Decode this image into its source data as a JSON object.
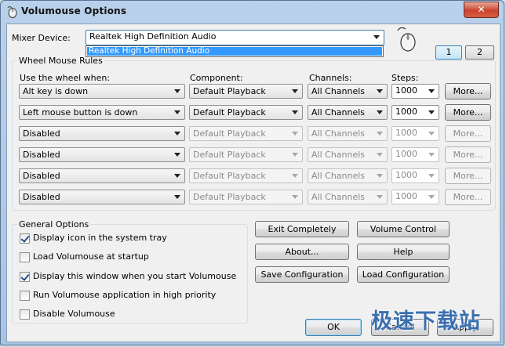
{
  "window": {
    "title": "Volumouse Options",
    "close_label": "✕"
  },
  "mixer": {
    "label": "Mixer Device:",
    "selected": "Realtek High Definition Audio",
    "dropdown_option": "Realtek High Definition Audio"
  },
  "tabs": [
    "1",
    "2"
  ],
  "rules": {
    "group_title": "Wheel Mouse Rules",
    "headers": {
      "use_when": "Use the wheel when:",
      "component": "Component:",
      "channels": "Channels:",
      "steps": "Steps:"
    },
    "rows": [
      {
        "when": "Alt key is down",
        "component": "Default Playback",
        "channels": "All Channels",
        "steps": "1000",
        "more": "More...",
        "enabled": true
      },
      {
        "when": "Left mouse button is down",
        "component": "Default Playback",
        "channels": "All Channels",
        "steps": "1000",
        "more": "More...",
        "enabled": true
      },
      {
        "when": "Disabled",
        "component": "Default Playback",
        "channels": "All Channels",
        "steps": "1000",
        "more": "More...",
        "enabled": false
      },
      {
        "when": "Disabled",
        "component": "Default Playback",
        "channels": "All Channels",
        "steps": "1000",
        "more": "More...",
        "enabled": false
      },
      {
        "when": "Disabled",
        "component": "Default Playback",
        "channels": "All Channels",
        "steps": "1000",
        "more": "More...",
        "enabled": false
      },
      {
        "when": "Disabled",
        "component": "Default Playback",
        "channels": "All Channels",
        "steps": "1000",
        "more": "More...",
        "enabled": false
      }
    ]
  },
  "general": {
    "group_title": "General Options",
    "options": [
      {
        "label": "Display icon in the system tray",
        "checked": true
      },
      {
        "label": "Load Volumouse at startup",
        "checked": false
      },
      {
        "label": "Display this window when you start Volumouse",
        "checked": true
      },
      {
        "label": "Run Volumouse application in high priority",
        "checked": false
      },
      {
        "label": "Disable Volumouse",
        "checked": false
      }
    ]
  },
  "actions": {
    "exit_completely": "Exit Completely",
    "volume_control": "Volume Control",
    "about": "About...",
    "help": "Help",
    "save_configuration": "Save Configuration",
    "load_configuration": "Load Configuration"
  },
  "footer": {
    "ok": "OK",
    "cancel": "Cancel",
    "apply": "Apply"
  },
  "watermark": "极速下载站"
}
